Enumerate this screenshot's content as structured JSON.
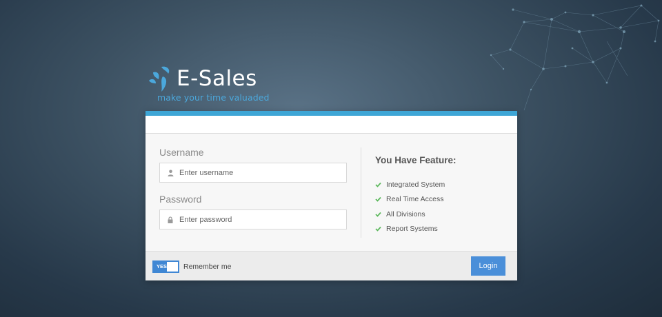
{
  "brand": {
    "name": "E-Sales",
    "tagline": "make your time valuaded"
  },
  "login_form": {
    "username": {
      "label": "Username",
      "placeholder": "Enter username",
      "icon": "user-icon"
    },
    "password": {
      "label": "Password",
      "placeholder": "Enter password",
      "icon": "lock-icon"
    }
  },
  "features": {
    "title": "You Have Feature:",
    "items": [
      {
        "label": "Integrated System",
        "icon": "check-icon"
      },
      {
        "label": "Real Time Access",
        "icon": "check-icon"
      },
      {
        "label": "All Divisions",
        "icon": "check-icon"
      },
      {
        "label": "Report Systems",
        "icon": "check-icon"
      }
    ]
  },
  "footer": {
    "remember_toggle": {
      "state_label": "YES",
      "on": true
    },
    "remember_label": "Remember me",
    "login_label": "Login"
  },
  "colors": {
    "accent": "#3ea6d6",
    "button": "#4a8fd9",
    "check": "#5cb85c",
    "tagline": "#4ba8dc"
  }
}
